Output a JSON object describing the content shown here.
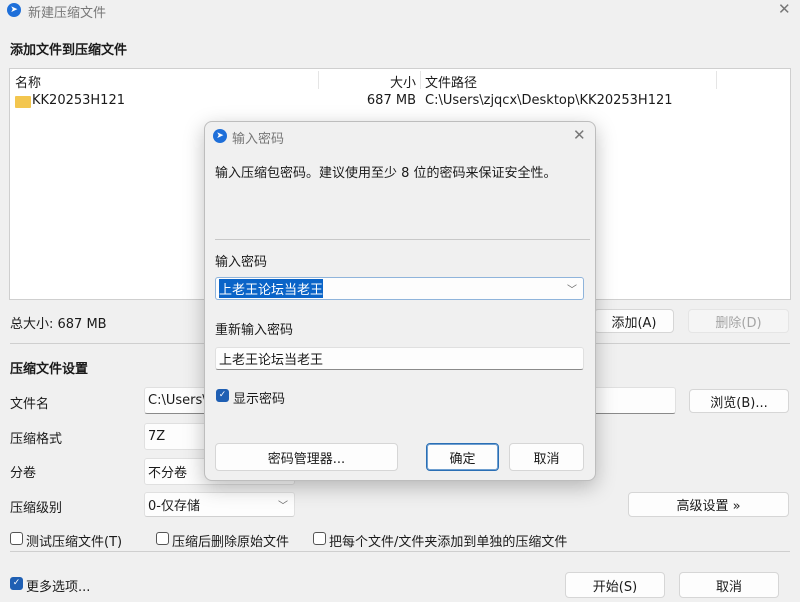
{
  "window": {
    "title": "新建压缩文件",
    "close_label": "✕"
  },
  "files_section": {
    "heading": "添加文件到压缩文件",
    "columns": [
      "名称",
      "大小",
      "文件路径"
    ],
    "rows": [
      {
        "name": "KK20253H121",
        "size": "687 MB",
        "path": "C:\\Users\\zjqcx\\Desktop\\KK20253H121"
      }
    ],
    "total": "总大小: 687 MB",
    "add_label": "添加(A)",
    "delete_label": "删除(D)"
  },
  "settings": {
    "heading": "压缩文件设置",
    "filename_label": "文件名",
    "filename_value": "C:\\Users\\",
    "browse_label": "浏览(B)...",
    "format_label": "压缩格式",
    "format_value": "7Z",
    "split_label": "分卷",
    "split_value": "不分卷",
    "level_label": "压缩级别",
    "level_value": "0-仅存储",
    "advanced_label": "高级设置 »",
    "checkboxes": [
      {
        "label": "测试压缩文件(T)",
        "checked": false
      },
      {
        "label": "压缩后删除原始文件",
        "checked": false
      },
      {
        "label": "把每个文件/文件夹添加到单独的压缩文件",
        "checked": false
      }
    ]
  },
  "footer": {
    "more_options": "更多选项...",
    "start_label": "开始(S)",
    "cancel_label": "取消"
  },
  "dialog": {
    "title": "输入密码",
    "message": "输入压缩包密码。建议使用至少 8 位的密码来保证安全性。",
    "password_label": "输入密码",
    "password_value": "上老王论坛当老王",
    "confirm_label": "重新输入密码",
    "confirm_value": "上老王论坛当老王",
    "show_password": "显示密码",
    "manager_label": "密码管理器...",
    "ok_label": "确定",
    "cancel_label": "取消"
  }
}
